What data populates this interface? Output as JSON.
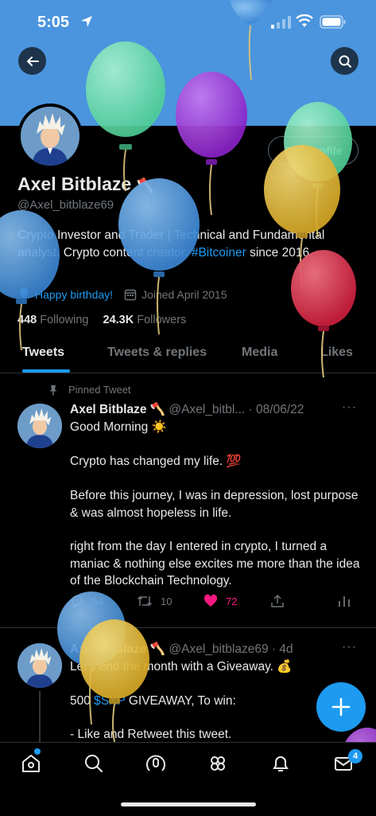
{
  "status_bar": {
    "time": "5:05"
  },
  "profile": {
    "name": "Axel Bitblaze",
    "name_emoji": "🪓",
    "handle": "@Axel_bitblaze69",
    "edit_label": "Edit profile",
    "bio_part1": "Crypto Investor and Trader | Technical and Fundamental analyst. Crypto content creator. ",
    "bio_hashtag": "#Bitcoiner",
    "bio_part2": " since 2016.",
    "birthday": "Happy birthday!",
    "joined": "Joined April 2015",
    "following_count": "448",
    "following_label": "Following",
    "followers_count": "24.3K",
    "followers_label": "Followers"
  },
  "tabs": [
    "Tweets",
    "Tweets & replies",
    "Media",
    "Likes"
  ],
  "pinned_label": "Pinned Tweet",
  "tweet1": {
    "name": "Axel Bitblaze 🪓",
    "handle_date": "@Axel_bitbl... · 08/06/22",
    "line1": "Good Morning ☀️",
    "line2": "Crypto has changed my life. 💯",
    "line3": "Before this journey, I was in depression, lost purpose & was almost hopeless in life.",
    "line4": "right from the day I entered in crypto, I turned a maniac & nothing else excites me more than the idea of the Blockchain Technology.",
    "replies": "54",
    "retweets": "10",
    "likes": "72"
  },
  "tweet2": {
    "name": "Axel Bitblaze 🪓",
    "handle_date": "@Axel_bitblaze69 · 4d",
    "line1": "Let's end the month with a Giveaway. 💰",
    "line2_pre": "500 ",
    "line2_cash": "$SXP",
    "line2_post": " GIVEAWAY, To win:",
    "line3": "- Like and Retweet this tweet."
  },
  "nav": {
    "messages_badge": "4"
  },
  "icons": [
    "back-arrow-icon",
    "search-icon",
    "pin-icon",
    "balloon-icon",
    "calendar-icon",
    "reply-icon",
    "retweet-icon",
    "heart-icon",
    "share-icon",
    "analytics-icon",
    "compose-plus-icon",
    "home-icon",
    "spaces-icon",
    "communities-icon",
    "bell-icon",
    "mail-icon"
  ],
  "colors": {
    "accent": "#1d9bf0",
    "banner": "#4a95de",
    "like": "#f91880",
    "background": "#000000"
  }
}
